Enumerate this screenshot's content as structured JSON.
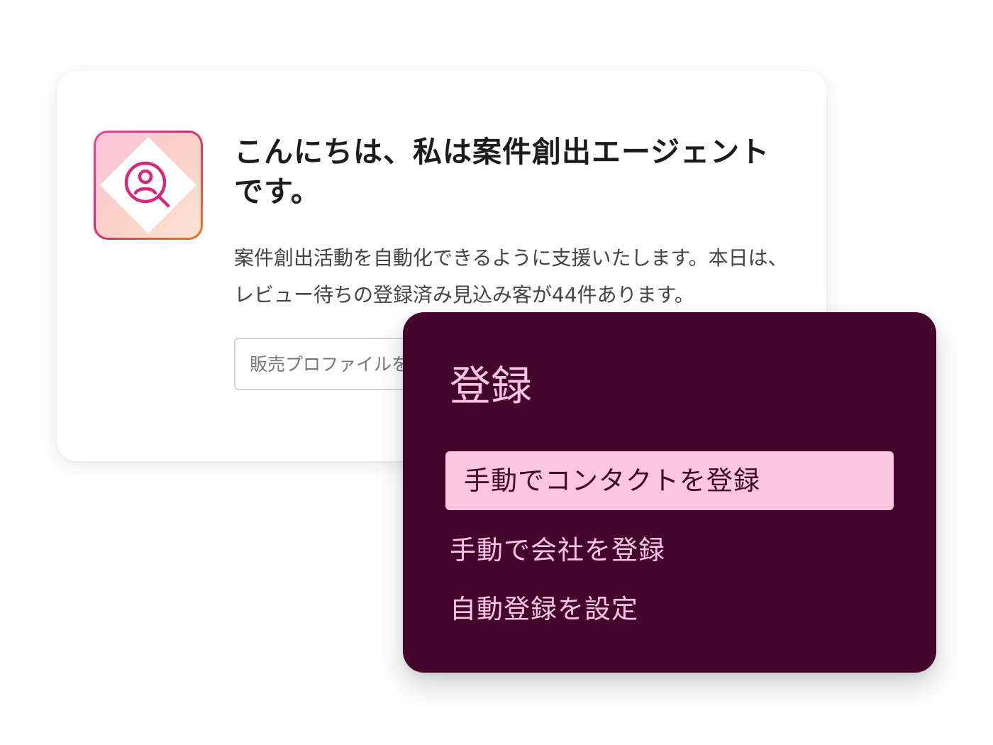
{
  "agent_card": {
    "icon": "person-search-icon",
    "title": "こんにちは、私は案件創出エージェントです。",
    "description": "案件創出活動を自動化できるように支援いたします。本日は、レビュー待ちの登録済み見込み客が44件あります。",
    "input": {
      "placeholder": "販売プロファイルを",
      "value": ""
    }
  },
  "register_menu": {
    "title": "登録",
    "items": [
      {
        "label": "手動でコンタクトを登録",
        "selected": true
      },
      {
        "label": "手動で会社を登録",
        "selected": false
      },
      {
        "label": "自動登録を設定",
        "selected": false
      }
    ]
  },
  "colors": {
    "menu_background": "#45062d",
    "menu_text": "#fcc5e2",
    "menu_highlight": "#fcc5e2",
    "icon_accent": "#d6297b",
    "icon_gradient_end": "#f97316"
  }
}
